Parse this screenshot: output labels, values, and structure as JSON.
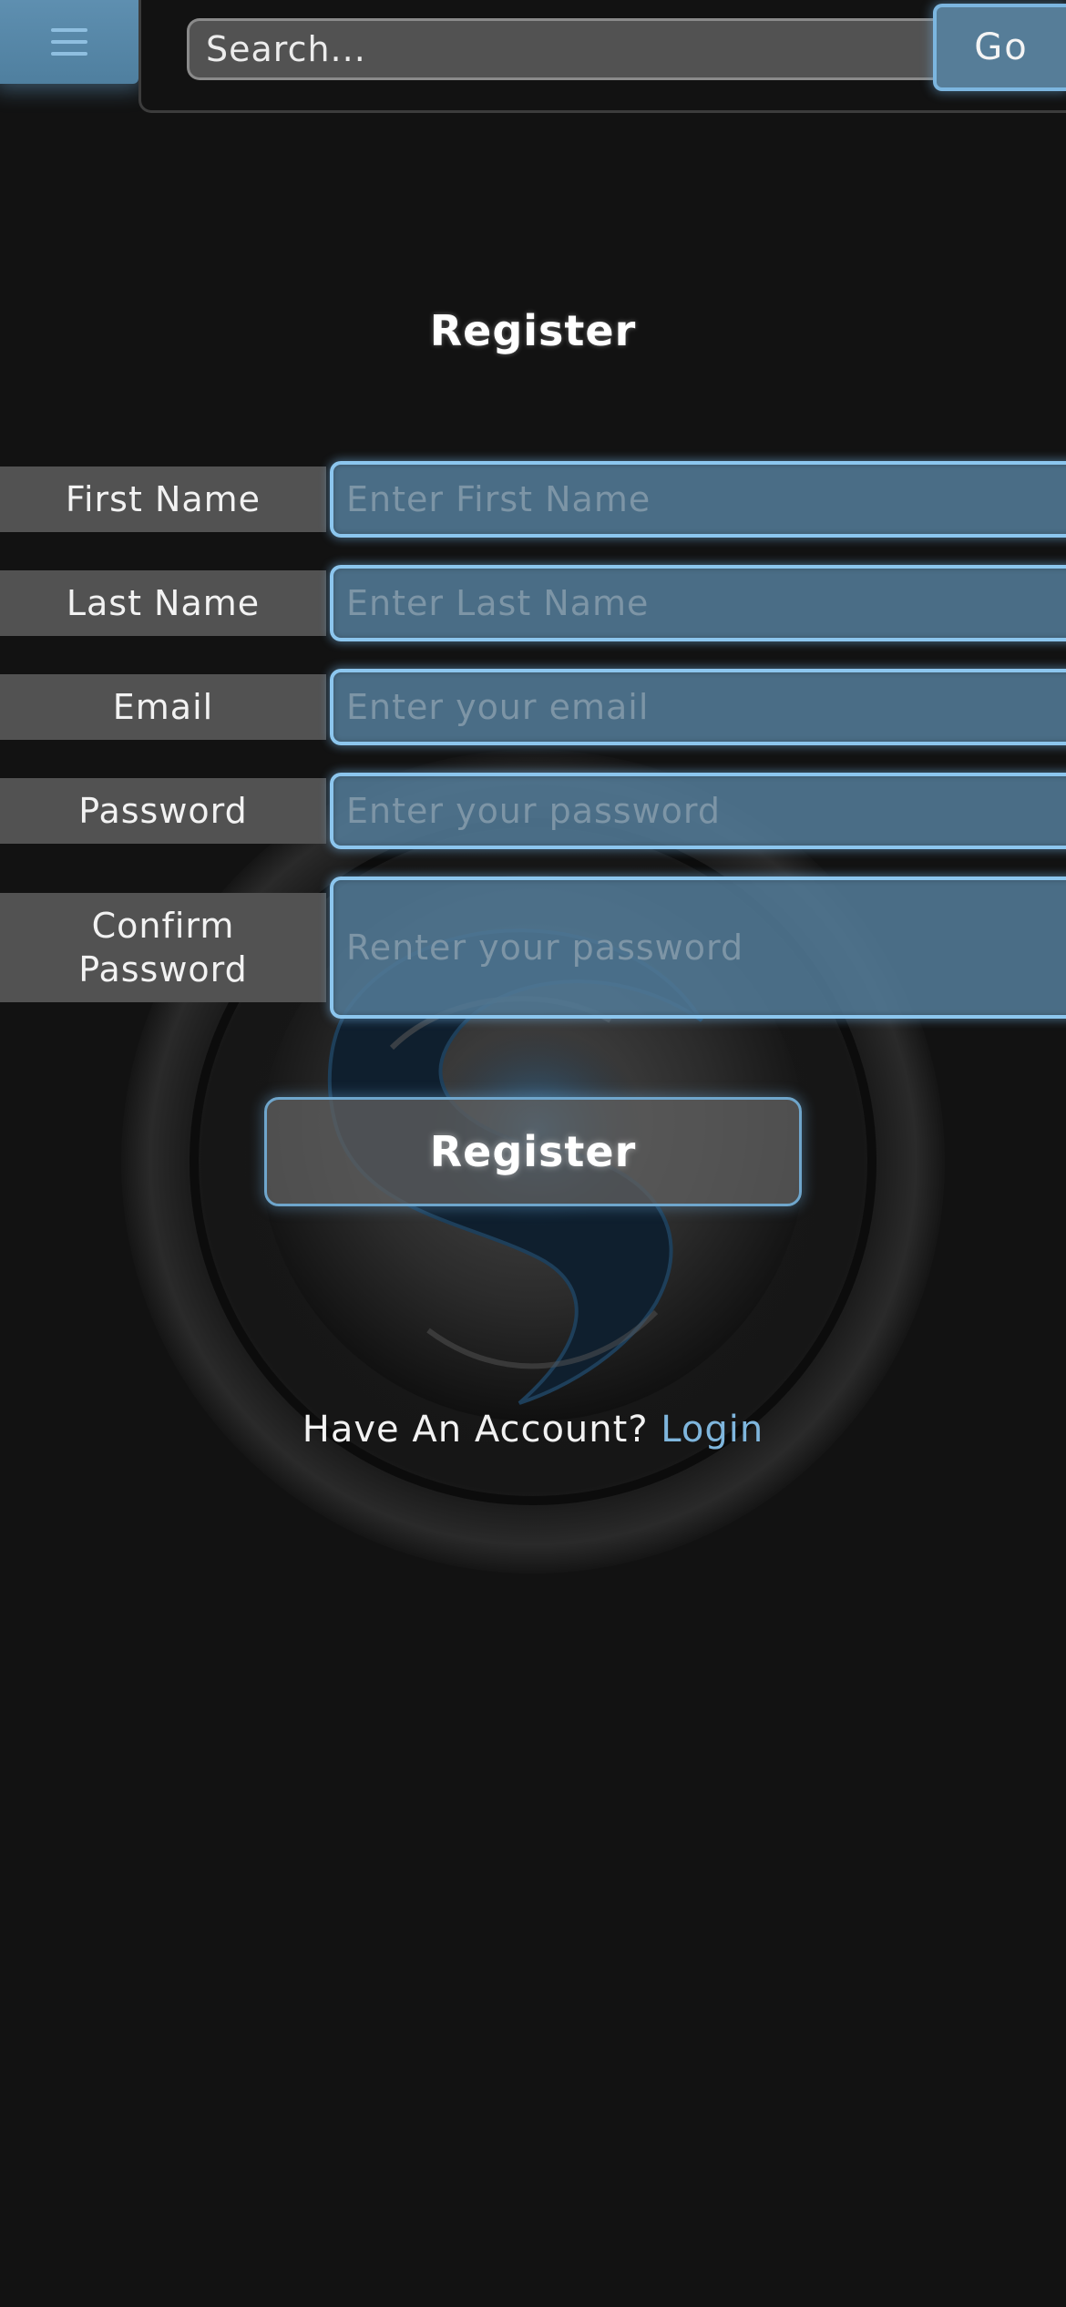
{
  "header": {
    "menu_icon": "hamburger-menu-icon",
    "search": {
      "placeholder": "Search...",
      "value": ""
    },
    "go_label": "Go"
  },
  "form": {
    "title": "Register",
    "fields": [
      {
        "label": "First Name",
        "placeholder": "Enter First Name"
      },
      {
        "label": "Last Name",
        "placeholder": "Enter Last Name"
      },
      {
        "label": "Email",
        "placeholder": "Enter your email"
      },
      {
        "label": "Password",
        "placeholder": "Enter your password"
      },
      {
        "label_line1": "Confirm",
        "label_line2": "Password",
        "placeholder": "Renter your password"
      }
    ],
    "submit_label": "Register"
  },
  "footer": {
    "prompt": "Have An Account?",
    "login_label": "Login"
  },
  "colors": {
    "background": "#121212",
    "accent": "#7fb6dd",
    "input_fill": "#527a96",
    "label_fill": "#525252"
  }
}
